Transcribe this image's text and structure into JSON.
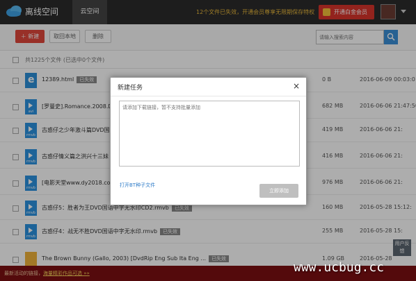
{
  "app": {
    "title": "离线空间",
    "tab_cloud": "云空间"
  },
  "header": {
    "promo_text": "12个文件已失效，开通会员尊享无限期保存特权",
    "vip_button": "开通白金会员"
  },
  "toolbar": {
    "new_label": "＋ 新建",
    "save_local_label": "取回本地",
    "delete_label": "删除",
    "search_placeholder": "请输入搜索内容"
  },
  "list": {
    "summary": "共1225个文件 (已选中0个文件)",
    "rows": [
      {
        "name": "12389.html",
        "status": "已失效",
        "size": "0 B",
        "date": "2016-06-09 00:03:0",
        "type": "ie",
        "ext": ""
      },
      {
        "name": "[罗曼史].Romance.2008.D",
        "status": "",
        "size": "682 MB",
        "date": "2016-06-06 21:47:50",
        "type": "video",
        "ext": "avi"
      },
      {
        "name": "古惑仔之少年激斗篇DVD国",
        "status": "",
        "size": "419 MB",
        "date": "2016-06-06 21:",
        "type": "video",
        "ext": "rmvb"
      },
      {
        "name": "古惑仔情义篇之洪兴十三妹",
        "status": "",
        "size": "416 MB",
        "date": "2016-06-06 21:",
        "type": "video",
        "ext": "rmvb"
      },
      {
        "name": "[电影天堂www.dy2018.co",
        "status": "",
        "size": "976 MB",
        "date": "2016-06-06 21:",
        "type": "video",
        "ext": "rmvb"
      },
      {
        "name": "古惑仔5：胜者为王DVD国语中字无水印CD2.rmvb",
        "status": "已失效",
        "size": "160 MB",
        "date": "2016-05-28 15:12:",
        "type": "video",
        "ext": "rmvb"
      },
      {
        "name": "古惑仔4：战无不胜DVD国语中字无水印.rmvb",
        "status": "已失效",
        "size": "255 MB",
        "date": "2016-05-28 15:",
        "type": "video",
        "ext": "rmvb"
      },
      {
        "name": "The Brown Bunny (Gallo, 2003) [DvdRip Eng Sub Ita Eng ...",
        "status": "已失效",
        "size": "1.09 GB",
        "date": "2016-05-28",
        "type": "folder",
        "ext": ""
      }
    ]
  },
  "dialog": {
    "title": "新建任务",
    "close_glyph": "×",
    "textarea_placeholder": "请添加下载链接，暂不支持批量添加",
    "bt_link": "打开BT种子文件",
    "submit_label": "立即添加"
  },
  "footer": {
    "text": "最新活动的链接，",
    "link": "海量精彩作品可选 »»"
  },
  "feedback_label": "用户反馈",
  "watermark": "www.ucbug.cc"
}
